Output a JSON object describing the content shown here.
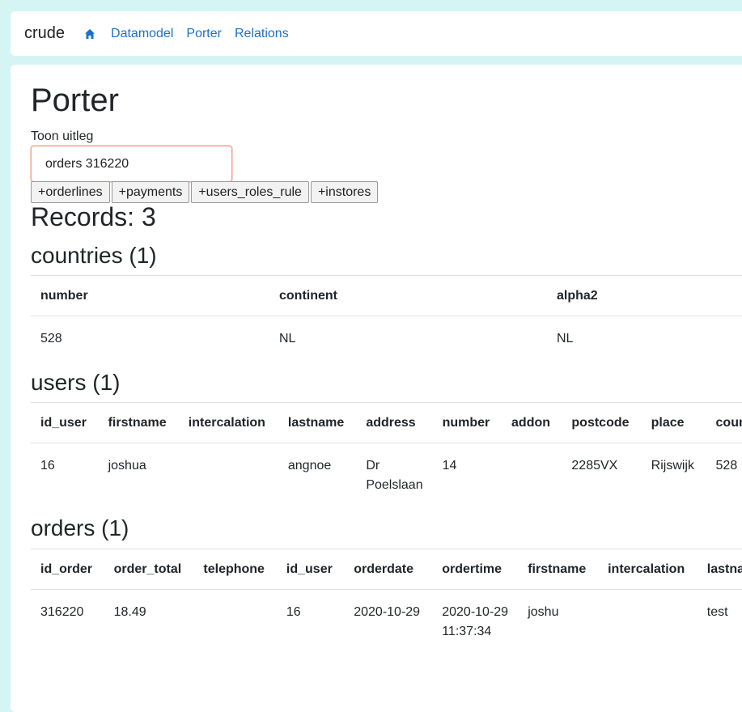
{
  "nav": {
    "brand": "crude",
    "home_icon": "home-icon",
    "links": [
      "Datamodel",
      "Porter",
      "Relations"
    ]
  },
  "page": {
    "title": "Porter",
    "toggle_label": "Toon uitleg",
    "search_value": "orders 316220",
    "buttons": [
      "+orderlines",
      "+payments",
      "+users_roles_rule",
      "+instores"
    ],
    "records_label": "Records: 3"
  },
  "countries": {
    "heading": "countries (1)",
    "columns": [
      "number",
      "continent",
      "alpha2"
    ],
    "rows": [
      [
        "528",
        "NL",
        "NL"
      ]
    ]
  },
  "users": {
    "heading": "users (1)",
    "columns": [
      "id_user",
      "firstname",
      "intercalation",
      "lastname",
      "address",
      "number",
      "addon",
      "postcode",
      "place",
      "country"
    ],
    "rows": [
      [
        "16",
        "joshua",
        "",
        "angnoe",
        "Dr Poelslaan",
        "14",
        "",
        "2285VX",
        "Rijswijk",
        "528"
      ]
    ]
  },
  "orders": {
    "heading": "orders (1)",
    "columns": [
      "id_order",
      "order_total",
      "telephone",
      "id_user",
      "orderdate",
      "ordertime",
      "firstname",
      "intercalation",
      "lastname"
    ],
    "rows": [
      [
        "316220",
        "18.49",
        "",
        "16",
        "2020-10-29",
        "2020-10-29 11:37:34",
        "joshu",
        "",
        "test"
      ]
    ]
  }
}
